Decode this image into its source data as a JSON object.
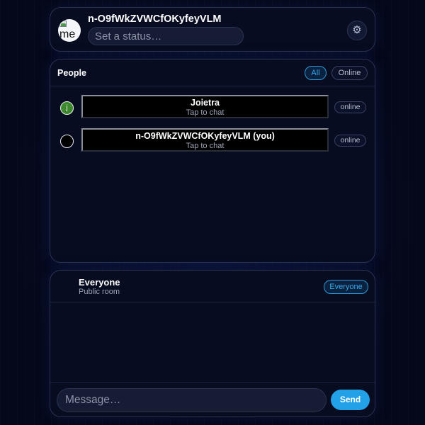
{
  "profile": {
    "name": "n-O9fWkZVWCfOKyfeyVLM",
    "avatar_alt": "me",
    "status_placeholder": "Set a status…",
    "settings_icon": "gear-icon",
    "settings_glyph": "⚙"
  },
  "people": {
    "title": "People",
    "filters": [
      {
        "label": "All",
        "active": true
      },
      {
        "label": "Online",
        "active": false
      }
    ],
    "items": [
      {
        "name": "Joietra",
        "subtitle": "Tap to chat",
        "avatar_initial": "j",
        "status": "online"
      },
      {
        "name": "n-O9fWkZVWCfOKyfeyVLM (you)",
        "subtitle": "Tap to chat",
        "avatar_initial": "",
        "status": "online"
      }
    ]
  },
  "room": {
    "title": "Everyone",
    "subtitle": "Public room",
    "badge": "Everyone",
    "message_placeholder": "Message…",
    "send_label": "Send"
  },
  "colors": {
    "background": "#05081a",
    "card": "#070c20",
    "accent": "#22a0e8",
    "avatar_green": "#3d8a2e"
  }
}
